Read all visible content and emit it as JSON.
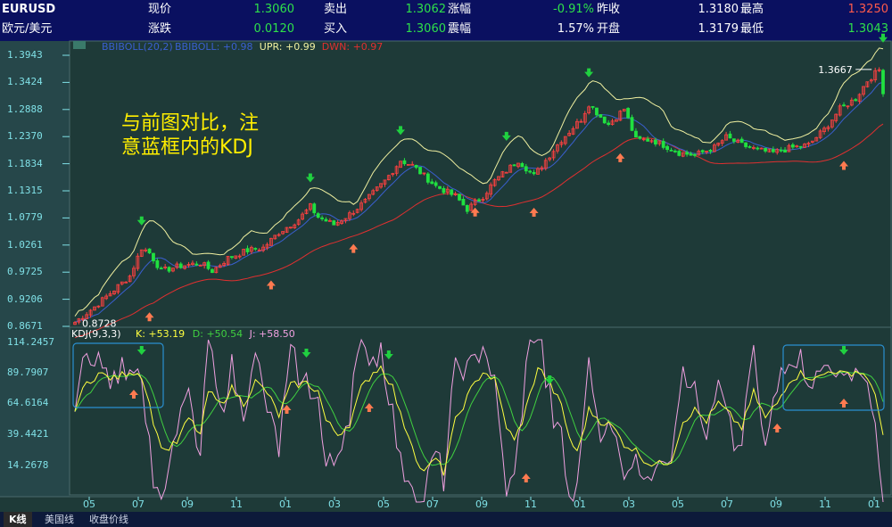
{
  "quote": {
    "symbol": "EURUSD",
    "name": "欧元/美元",
    "cells": [
      {
        "label": "现价",
        "value": "1.3060",
        "color": "#2ee04a"
      },
      {
        "label": "卖出",
        "value": "1.3062",
        "color": "#2ee04a"
      },
      {
        "label": "涨幅",
        "value": "-0.91%",
        "color": "#2ee04a"
      },
      {
        "label": "昨收",
        "value": "1.3180",
        "color": "#ffffff"
      },
      {
        "label": "最高",
        "value": "1.3250",
        "color": "#ff5a4a"
      },
      {
        "label": "涨跌",
        "value": "0.0120",
        "color": "#2ee04a"
      },
      {
        "label": "买入",
        "value": "1.3060",
        "color": "#2ee04a"
      },
      {
        "label": "震幅",
        "value": "1.57%",
        "color": "#ffffff"
      },
      {
        "label": "开盘",
        "value": "1.3179",
        "color": "#ffffff"
      },
      {
        "label": "最低",
        "value": "1.3043",
        "color": "#2ee04a"
      }
    ]
  },
  "main_chart": {
    "indicator": "BBIBOLL(20,2)",
    "legend": [
      {
        "text": "BBIBOLL: +0.98",
        "color": "#3a5fd0"
      },
      {
        "text": "UPR: +0.99",
        "color": "#f0f0a0"
      },
      {
        "text": "DWN: +0.97",
        "color": "#e03030"
      }
    ],
    "y_ticks": [
      "1.3943",
      "1.3424",
      "1.2888",
      "1.2370",
      "1.1834",
      "1.1315",
      "1.0779",
      "1.0261",
      "0.9725",
      "0.9206",
      "0.8671"
    ],
    "ylim": [
      0.8671,
      1.3943
    ],
    "annotation_high": "1.3667",
    "annotation_low": "0.8728",
    "note_line1": "与前图对比，注",
    "note_line2": "意蓝框内的KDJ"
  },
  "kdj_chart": {
    "indicator": "KDJ(9,3,3)",
    "legend": [
      {
        "text": "K: +53.19",
        "color": "#ffff40"
      },
      {
        "text": "D: +50.54",
        "color": "#40d040"
      },
      {
        "text": "J: +58.50",
        "color": "#f0a0e0"
      }
    ],
    "y_ticks": [
      "114.2457",
      "89.7907",
      "64.6164",
      "39.4421",
      "14.2678"
    ],
    "ylim": [
      0,
      120
    ]
  },
  "x_ticks": [
    "05",
    "07",
    "09",
    "11",
    "01",
    "03",
    "05",
    "07",
    "09",
    "11",
    "01",
    "03",
    "05",
    "07",
    "09",
    "11",
    "01"
  ],
  "tabs": [
    "K线",
    "美国线",
    "收盘价线"
  ],
  "colors": {
    "up": "#ff4040",
    "down": "#20e040",
    "mid": "#3a5fd0",
    "upper": "#f0f0a0",
    "lower": "#e03030",
    "k": "#ffff40",
    "d": "#40d040",
    "j": "#f0a0e0",
    "arrow_green": "#20d040",
    "arrow_red": "#ff7a50",
    "box": "#2a8fd0"
  },
  "chart_data": [
    {
      "type": "line",
      "title": "",
      "price_path": [
        [
          0,
          0.875
        ],
        [
          5,
          0.905
        ],
        [
          14,
          0.965
        ],
        [
          17,
          1.02
        ],
        [
          19,
          1.01
        ],
        [
          22,
          0.975
        ],
        [
          27,
          0.985
        ],
        [
          32,
          0.99
        ],
        [
          35,
          0.975
        ],
        [
          39,
          1.0
        ],
        [
          44,
          1.015
        ],
        [
          48,
          1.02
        ],
        [
          52,
          1.05
        ],
        [
          57,
          1.075
        ],
        [
          60,
          1.1
        ],
        [
          62,
          1.08
        ],
        [
          66,
          1.065
        ],
        [
          70,
          1.085
        ],
        [
          74,
          1.11
        ],
        [
          79,
          1.15
        ],
        [
          83,
          1.19
        ],
        [
          86,
          1.18
        ],
        [
          89,
          1.16
        ],
        [
          92,
          1.14
        ],
        [
          97,
          1.12
        ],
        [
          100,
          1.095
        ],
        [
          104,
          1.12
        ],
        [
          107,
          1.15
        ],
        [
          110,
          1.17
        ],
        [
          113,
          1.19
        ],
        [
          117,
          1.16
        ],
        [
          120,
          1.19
        ],
        [
          124,
          1.23
        ],
        [
          129,
          1.27
        ],
        [
          131,
          1.3
        ],
        [
          134,
          1.275
        ],
        [
          136,
          1.26
        ],
        [
          140,
          1.29
        ],
        [
          143,
          1.23
        ],
        [
          147,
          1.23
        ],
        [
          150,
          1.22
        ],
        [
          154,
          1.205
        ],
        [
          158,
          1.2
        ],
        [
          163,
          1.215
        ],
        [
          166,
          1.235
        ],
        [
          170,
          1.22
        ],
        [
          174,
          1.21
        ],
        [
          178,
          1.205
        ],
        [
          183,
          1.215
        ],
        [
          187,
          1.22
        ],
        [
          191,
          1.25
        ],
        [
          195,
          1.29
        ],
        [
          199,
          1.31
        ],
        [
          202,
          1.345
        ],
        [
          205,
          1.366
        ],
        [
          206,
          1.325
        ]
      ],
      "kdj_k_path": [
        [
          0,
          68
        ],
        [
          3,
          86
        ],
        [
          6,
          93
        ],
        [
          10,
          89
        ],
        [
          14,
          95
        ],
        [
          17,
          92
        ],
        [
          19,
          70
        ],
        [
          21,
          46
        ],
        [
          23,
          36
        ],
        [
          26,
          42
        ],
        [
          29,
          60
        ],
        [
          32,
          48
        ],
        [
          34,
          80
        ],
        [
          37,
          70
        ],
        [
          40,
          82
        ],
        [
          43,
          71
        ],
        [
          46,
          87
        ],
        [
          49,
          79
        ],
        [
          52,
          62
        ],
        [
          55,
          84
        ],
        [
          59,
          86
        ],
        [
          62,
          80
        ],
        [
          64,
          58
        ],
        [
          67,
          48
        ],
        [
          70,
          56
        ],
        [
          73,
          82
        ],
        [
          76,
          94
        ],
        [
          78,
          98
        ],
        [
          81,
          83
        ],
        [
          83,
          62
        ],
        [
          86,
          41
        ],
        [
          88,
          22
        ],
        [
          90,
          23
        ],
        [
          92,
          30
        ],
        [
          94,
          20
        ],
        [
          97,
          58
        ],
        [
          101,
          81
        ],
        [
          104,
          95
        ],
        [
          107,
          88
        ],
        [
          110,
          54
        ],
        [
          112,
          43
        ],
        [
          114,
          58
        ],
        [
          116,
          77
        ],
        [
          118,
          98
        ],
        [
          121,
          86
        ],
        [
          124,
          69
        ],
        [
          126,
          46
        ],
        [
          128,
          34
        ],
        [
          131,
          66
        ],
        [
          134,
          58
        ],
        [
          137,
          54
        ],
        [
          140,
          41
        ],
        [
          143,
          36
        ],
        [
          146,
          27
        ],
        [
          149,
          26
        ],
        [
          152,
          29
        ],
        [
          155,
          58
        ],
        [
          158,
          66
        ],
        [
          161,
          58
        ],
        [
          164,
          71
        ],
        [
          167,
          62
        ],
        [
          170,
          53
        ],
        [
          173,
          79
        ],
        [
          176,
          60
        ],
        [
          179,
          71
        ],
        [
          182,
          88
        ],
        [
          185,
          93
        ],
        [
          189,
          89
        ],
        [
          193,
          96
        ],
        [
          196,
          92
        ],
        [
          199,
          95
        ],
        [
          202,
          91
        ],
        [
          204,
          75
        ],
        [
          206,
          50
        ]
      ]
    }
  ]
}
